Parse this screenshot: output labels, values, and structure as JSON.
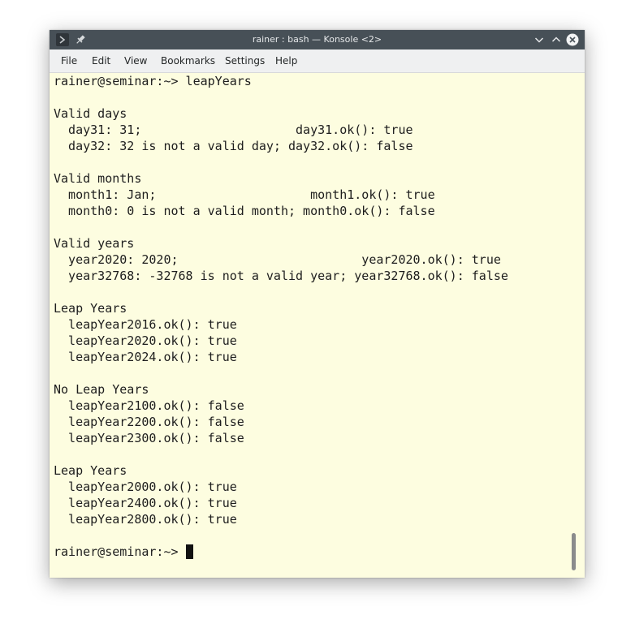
{
  "window": {
    "title": "rainer : bash — Konsole <2>"
  },
  "menu": {
    "items": [
      {
        "label": "File"
      },
      {
        "label": "Edit"
      },
      {
        "label": "View"
      },
      {
        "label": "Bookmarks"
      },
      {
        "label": "Settings"
      },
      {
        "label": "Help"
      }
    ]
  },
  "terminal": {
    "prompt": "rainer@seminar:~> ",
    "lines": [
      "rainer@seminar:~> leapYears",
      "",
      "Valid days",
      "  day31: 31;                     day31.ok(): true",
      "  day32: 32 is not a valid day; day32.ok(): false",
      "",
      "Valid months",
      "  month1: Jan;                     month1.ok(): true",
      "  month0: 0 is not a valid month; month0.ok(): false",
      "",
      "Valid years",
      "  year2020: 2020;                         year2020.ok(): true",
      "  year32768: -32768 is not a valid year; year32768.ok(): false",
      "",
      "Leap Years",
      "  leapYear2016.ok(): true",
      "  leapYear2020.ok(): true",
      "  leapYear2024.ok(): true",
      "",
      "No Leap Years",
      "  leapYear2100.ok(): false",
      "  leapYear2200.ok(): false",
      "  leapYear2300.ok(): false",
      "",
      "Leap Years",
      "  leapYear2000.ok(): true",
      "  leapYear2400.ok(): true",
      "  leapYear2800.ok(): true",
      ""
    ]
  },
  "icons": {
    "app": "terminal-icon",
    "pin": "pin-icon",
    "minimize": "chevron-down-icon",
    "maximize": "chevron-up-icon",
    "close": "close-icon"
  },
  "colors": {
    "titlebar": "#475057",
    "menubar": "#eff0f1",
    "terminal_bg": "#fdfde0",
    "terminal_fg": "#1d1d1d"
  }
}
